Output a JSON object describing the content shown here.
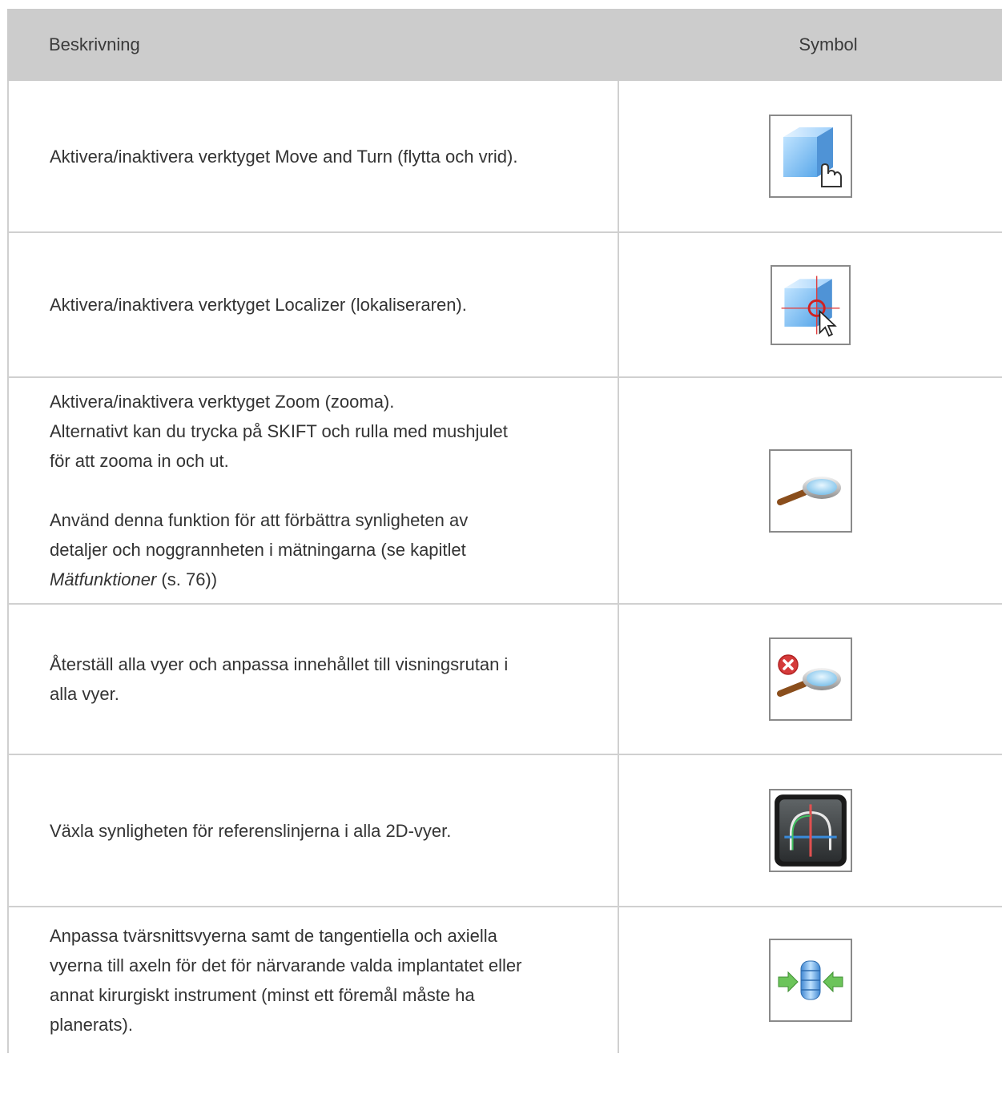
{
  "header": {
    "col_description": "Beskrivning",
    "col_symbol": "Symbol"
  },
  "rows": [
    {
      "text": "Aktivera/inaktivera verktyget Move and Turn (flytta och vrid).",
      "icon": "move-turn-icon"
    },
    {
      "text": "Aktivera/inaktivera verktyget Localizer  (lokaliseraren).",
      "icon": "localizer-icon"
    },
    {
      "line1": "Aktivera/inaktivera verktyget Zoom  (zooma).",
      "line2": "Alternativt kan du trycka på SKIFT och rulla med mushjulet",
      "line3": "för att zooma in och ut.",
      "line4": "Använd denna funktion för att förbättra synligheten av",
      "line5": "detaljer och noggrannheten i mätningarna (se kapitlet",
      "link": "Mätfunktioner",
      "after_link": " (s. 76))",
      "icon": "zoom-icon"
    },
    {
      "line1": "Återställ alla vyer och anpassa innehållet till visningsrutan i",
      "line2": "alla vyer.",
      "icon": "reset-zoom-icon"
    },
    {
      "text": "Växla synligheten för referenslinjerna i alla 2D-vyer.",
      "icon": "reference-lines-icon"
    },
    {
      "line1": "Anpassa tvärsnittsvyerna samt de tangentiella och axiella",
      "line2": "vyerna till axeln för det för närvarande valda implantatet eller",
      "line3": "annat kirurgiskt instrument (minst ett föremål måste ha",
      "line4": "planerats).",
      "icon": "align-implant-axis-icon"
    }
  ]
}
